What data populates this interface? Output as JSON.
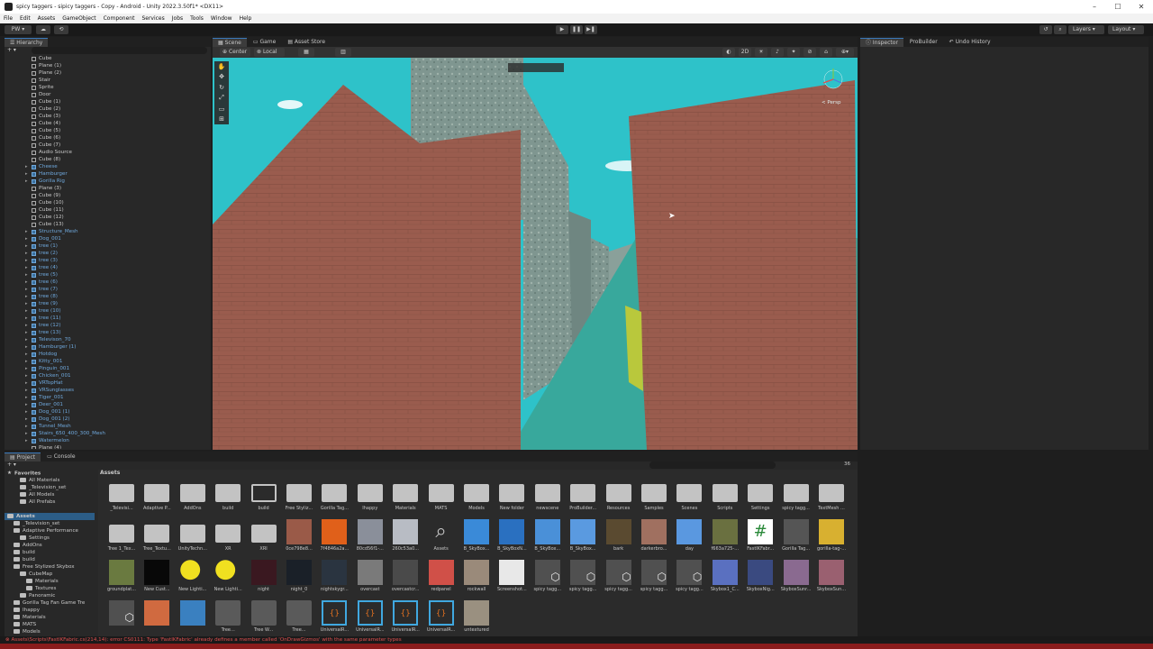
{
  "window": {
    "title": "spicy taggers - sipicy taggers - Copy - Android - Unity 2022.3.50f1* <DX11>",
    "controls": [
      "–",
      "☐",
      "✕"
    ]
  },
  "menu": [
    "File",
    "Edit",
    "Assets",
    "GameObject",
    "Component",
    "Services",
    "Jobs",
    "Tools",
    "Window",
    "Help"
  ],
  "toolbar": {
    "account": "PW ▾",
    "layers": "Layers",
    "layout": "Layout"
  },
  "hierarchy": {
    "tab": "Hierarchy",
    "add": "+ ▾",
    "items": [
      {
        "label": "Cube",
        "blue": false
      },
      {
        "label": "Plane (1)",
        "blue": false
      },
      {
        "label": "Plane (2)",
        "blue": false
      },
      {
        "label": "Stair",
        "blue": false
      },
      {
        "label": "Sprite",
        "blue": false
      },
      {
        "label": "Door",
        "blue": false
      },
      {
        "label": "Cube (1)",
        "blue": false
      },
      {
        "label": "Cube (2)",
        "blue": false
      },
      {
        "label": "Cube (3)",
        "blue": false
      },
      {
        "label": "Cube (4)",
        "blue": false
      },
      {
        "label": "Cube (5)",
        "blue": false
      },
      {
        "label": "Cube (6)",
        "blue": false
      },
      {
        "label": "Cube (7)",
        "blue": false
      },
      {
        "label": "Audio Source",
        "blue": false
      },
      {
        "label": "Cube (8)",
        "blue": false
      },
      {
        "label": "Cheese",
        "blue": true
      },
      {
        "label": "Hamburger",
        "blue": true
      },
      {
        "label": "Gorilla Rig",
        "blue": true
      },
      {
        "label": "Plane (3)",
        "blue": false
      },
      {
        "label": "Cube (9)",
        "blue": false
      },
      {
        "label": "Cube (10)",
        "blue": false
      },
      {
        "label": "Cube (11)",
        "blue": false
      },
      {
        "label": "Cube (12)",
        "blue": false
      },
      {
        "label": "Cube (13)",
        "blue": false
      },
      {
        "label": "Structure_Mesh",
        "blue": true
      },
      {
        "label": "Dog_001",
        "blue": true
      },
      {
        "label": "tree (1)",
        "blue": true
      },
      {
        "label": "tree (2)",
        "blue": true
      },
      {
        "label": "tree (3)",
        "blue": true
      },
      {
        "label": "tree (4)",
        "blue": true
      },
      {
        "label": "tree (5)",
        "blue": true
      },
      {
        "label": "tree (6)",
        "blue": true
      },
      {
        "label": "tree (7)",
        "blue": true
      },
      {
        "label": "tree (8)",
        "blue": true
      },
      {
        "label": "tree (9)",
        "blue": true
      },
      {
        "label": "tree (10)",
        "blue": true
      },
      {
        "label": "tree (11)",
        "blue": true
      },
      {
        "label": "tree (12)",
        "blue": true
      },
      {
        "label": "tree (13)",
        "blue": true
      },
      {
        "label": "Televison_70",
        "blue": true
      },
      {
        "label": "Hamburger (1)",
        "blue": true
      },
      {
        "label": "Hotdog",
        "blue": true
      },
      {
        "label": "Kitty_001",
        "blue": true
      },
      {
        "label": "Pinguin_001",
        "blue": true
      },
      {
        "label": "Chicken_001",
        "blue": true
      },
      {
        "label": "VRTopHat",
        "blue": true
      },
      {
        "label": "VRSunglasses",
        "blue": true
      },
      {
        "label": "Tiger_001",
        "blue": true
      },
      {
        "label": "Deer_001",
        "blue": true
      },
      {
        "label": "Dog_001 (1)",
        "blue": true
      },
      {
        "label": "Dog_001 (2)",
        "blue": true
      },
      {
        "label": "Tunnel_Mesh",
        "blue": true
      },
      {
        "label": "Stairs_650_400_300_Mesh",
        "blue": true
      },
      {
        "label": "Watermelon",
        "blue": true
      },
      {
        "label": "Plane (4)",
        "blue": false
      }
    ]
  },
  "scene": {
    "tabs": [
      "Scene",
      "Game",
      "Asset Store"
    ],
    "pivot": "Center",
    "space": "Local",
    "mode2d": "2D",
    "persp": "< Persp"
  },
  "inspector": {
    "tabs": [
      "Inspector",
      "ProBuilder",
      "Undo History"
    ]
  },
  "project": {
    "tabs": [
      "Project",
      "Console"
    ],
    "breadcrumb": "Assets",
    "count": "36",
    "tree": [
      {
        "label": "Favorites",
        "indent": 0,
        "bold": true
      },
      {
        "label": "All Materials",
        "indent": 2
      },
      {
        "label": "_Television_set",
        "indent": 2
      },
      {
        "label": "All Models",
        "indent": 2
      },
      {
        "label": "All Prefabs",
        "indent": 2
      },
      {
        "label": "",
        "indent": 0
      },
      {
        "label": "Assets",
        "indent": 0,
        "bold": true,
        "sel": true
      },
      {
        "label": "_Television_set",
        "indent": 1
      },
      {
        "label": "Adaptive Performance",
        "indent": 1
      },
      {
        "label": "Settings",
        "indent": 2
      },
      {
        "label": "AddOns",
        "indent": 1
      },
      {
        "label": "build",
        "indent": 1
      },
      {
        "label": "build",
        "indent": 1
      },
      {
        "label": "Free Stylized Skybox",
        "indent": 1
      },
      {
        "label": "CubeMap",
        "indent": 2
      },
      {
        "label": "Materials",
        "indent": 3
      },
      {
        "label": "Textures",
        "indent": 3
      },
      {
        "label": "Panoramic",
        "indent": 2
      },
      {
        "label": "Gorilla Tag Fan Game Tre",
        "indent": 1
      },
      {
        "label": "Ihappy",
        "indent": 1
      },
      {
        "label": "Materials",
        "indent": 1
      },
      {
        "label": "MATS",
        "indent": 1
      },
      {
        "label": "Models",
        "indent": 1
      }
    ],
    "assets": [
      {
        "label": "_Televisi...",
        "kind": "folder"
      },
      {
        "label": "Adaptive P...",
        "kind": "folder"
      },
      {
        "label": "AddOns",
        "kind": "folder"
      },
      {
        "label": "build",
        "kind": "folder"
      },
      {
        "label": "build",
        "kind": "folder-empty"
      },
      {
        "label": "Free Styliz...",
        "kind": "folder"
      },
      {
        "label": "Gorilla Tag...",
        "kind": "folder"
      },
      {
        "label": "Ihappy",
        "kind": "folder"
      },
      {
        "label": "Materials",
        "kind": "folder"
      },
      {
        "label": "MATS",
        "kind": "folder"
      },
      {
        "label": "Models",
        "kind": "folder"
      },
      {
        "label": "New folder",
        "kind": "folder"
      },
      {
        "label": "newscene",
        "kind": "folder"
      },
      {
        "label": "ProBuilder...",
        "kind": "folder"
      },
      {
        "label": "Resources",
        "kind": "folder"
      },
      {
        "label": "Samples",
        "kind": "folder"
      },
      {
        "label": "Scenes",
        "kind": "folder"
      },
      {
        "label": "Scripts",
        "kind": "folder"
      },
      {
        "label": "Settings",
        "kind": "folder"
      },
      {
        "label": "spicy tagg...",
        "kind": "folder"
      },
      {
        "label": "TextMesh ...",
        "kind": "folder"
      },
      {
        "label": "Tree 1_Tex...",
        "kind": "folder"
      },
      {
        "label": "Tree_Textu...",
        "kind": "folder"
      },
      {
        "label": "UnityTechn...",
        "kind": "folder"
      },
      {
        "label": "XR",
        "kind": "folder"
      },
      {
        "label": "XRI",
        "kind": "folder"
      },
      {
        "label": "0ce798e8...",
        "kind": "tex",
        "color": "#9a5a48"
      },
      {
        "label": "7f4846a2a...",
        "kind": "tex",
        "color": "#e0601a"
      },
      {
        "label": "80cd56f1-...",
        "kind": "tex",
        "color": "#8a8f9a"
      },
      {
        "label": "260c53a0...",
        "kind": "tex",
        "color": "#b8bcc4"
      },
      {
        "label": "Assets",
        "kind": "search"
      },
      {
        "label": "B_SkyBox...",
        "kind": "tex",
        "color": "#3a8ad8"
      },
      {
        "label": "B_SkyBoxN...",
        "kind": "tex",
        "color": "#2a70c0"
      },
      {
        "label": "B_SkyBox...",
        "kind": "tex",
        "color": "#4a90d8"
      },
      {
        "label": "B_SkyBox...",
        "kind": "tex",
        "color": "#5a9ae0"
      },
      {
        "label": "bark",
        "kind": "tex",
        "color": "#5a4a30"
      },
      {
        "label": "darkerbro...",
        "kind": "tex",
        "color": "#a07060"
      },
      {
        "label": "day",
        "kind": "tex",
        "color": "#5a98e0"
      },
      {
        "label": "f663a725-...",
        "kind": "tex",
        "color": "#6a7040"
      },
      {
        "label": "FastIKFabr...",
        "kind": "script",
        "color": "#ffffff"
      },
      {
        "label": "Gorilla Tag...",
        "kind": "tex",
        "color": "#555555"
      },
      {
        "label": "gorilla-tag-...",
        "kind": "tex",
        "color": "#d8b030"
      },
      {
        "label": "groundplat...",
        "kind": "tex",
        "color": "#6a7a40"
      },
      {
        "label": "New Cust...",
        "kind": "tex",
        "color": "#080808"
      },
      {
        "label": "New Lighti...",
        "kind": "light",
        "color": "#f0e020"
      },
      {
        "label": "New Lighti...",
        "kind": "light",
        "color": "#f0e020"
      },
      {
        "label": "night",
        "kind": "tex",
        "color": "#3a1820"
      },
      {
        "label": "night_0",
        "kind": "tex",
        "color": "#1a2028"
      },
      {
        "label": "nightskygr...",
        "kind": "tex",
        "color": "#2a3440"
      },
      {
        "label": "overcast",
        "kind": "tex",
        "color": "#7a7a7a"
      },
      {
        "label": "overcastcr...",
        "kind": "tex",
        "color": "#4a4a4a"
      },
      {
        "label": "redpanel",
        "kind": "tex",
        "color": "#d05048"
      },
      {
        "label": "rockwall",
        "kind": "tex",
        "color": "#9a8a7a"
      },
      {
        "label": "Screenshot...",
        "kind": "tex",
        "color": "#e8e8e8"
      },
      {
        "label": "spicy tagg...",
        "kind": "prefab",
        "color": "#505050"
      },
      {
        "label": "spicy tagg...",
        "kind": "prefab",
        "color": "#505050"
      },
      {
        "label": "spicy tagg...",
        "kind": "prefab",
        "color": "#505050"
      },
      {
        "label": "spicy tagg...",
        "kind": "prefab",
        "color": "#505050"
      },
      {
        "label": "spicy tagg...",
        "kind": "prefab",
        "color": "#505050"
      },
      {
        "label": "Skybox1_C...",
        "kind": "tex",
        "color": "#5a70c0"
      },
      {
        "label": "SkyboxNig...",
        "kind": "tex",
        "color": "#3a4a80"
      },
      {
        "label": "SkyboxSunr...",
        "kind": "tex",
        "color": "#8a6a90"
      },
      {
        "label": "SkyboxSun...",
        "kind": "tex",
        "color": "#9a6070"
      },
      {
        "label": "",
        "kind": "prefab",
        "color": "#505050"
      },
      {
        "label": "",
        "kind": "tex",
        "color": "#d06a40"
      },
      {
        "label": "",
        "kind": "tex",
        "color": "#3a80c0"
      },
      {
        "label": "Tree...",
        "kind": "mat",
        "color": "#5a5a5a"
      },
      {
        "label": "Tree W...",
        "kind": "mat",
        "color": "#5a5a5a"
      },
      {
        "label": "Tree...",
        "kind": "mat",
        "color": "#5a5a5a"
      },
      {
        "label": "UniversalR...",
        "kind": "cs",
        "color": "#40a8e0"
      },
      {
        "label": "UniversalR...",
        "kind": "cs",
        "color": "#40a8e0"
      },
      {
        "label": "UniversalR...",
        "kind": "cs",
        "color": "#40a8e0"
      },
      {
        "label": "UniversalR...",
        "kind": "cs",
        "color": "#40a8e0"
      },
      {
        "label": "untextured",
        "kind": "tex",
        "color": "#9a9080"
      }
    ]
  },
  "status": {
    "error": "Assets\\Scripts\\FastIKFabric.cs(214,14): error CS0111: Type 'FastIKFabric' already defines a member called 'OnDrawGizmos' with the same parameter types"
  },
  "colors": {
    "accent": "#3a79bb",
    "sky": "#2fc3c8",
    "brick": "#9a5c4e",
    "stone": "#8a9a90",
    "error": "#e05050"
  }
}
